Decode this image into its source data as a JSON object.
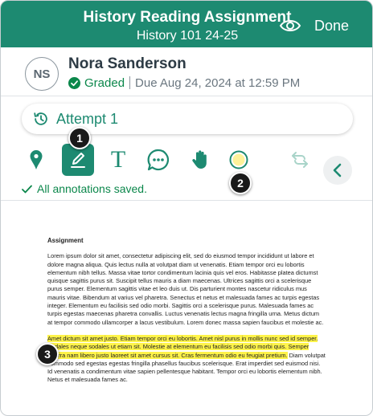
{
  "header": {
    "title": "History Reading Assignment",
    "subtitle": "History 101 24-25",
    "done_label": "Done"
  },
  "student": {
    "initials": "NS",
    "name": "Nora Sanderson",
    "status": "Graded",
    "due": "Due Aug 24, 2024 at 12:59 PM"
  },
  "attempt": {
    "label": "Attempt 1"
  },
  "toolbar": {
    "tools": [
      "pin-icon",
      "pen-icon",
      "text-icon",
      "comment-icon",
      "hand-icon",
      "color-picker"
    ],
    "active_tool": "pen-icon",
    "text_tool_glyph": "T",
    "saved_message": "All annotations saved."
  },
  "callouts": [
    "1",
    "2",
    "3"
  ],
  "colors": {
    "brand": "#1d8a71",
    "success": "#0b874b",
    "highlight": "#fff34a",
    "selected_color": "#fdf29a"
  },
  "document": {
    "title": "Assignment",
    "paragraph1": "Lorem ipsum dolor sit amet, consectetur adipiscing elit, sed do eiusmod tempor incididunt ut labore et dolore magna aliqua. Quis lectus nulla at volutpat diam ut venenatis. Etiam tempor orci eu lobortis elementum nibh tellus. Massa vitae tortor condimentum lacinia quis vel eros. Habitasse platea dictumst quisque sagittis purus sit. Suscipit tellus mauris a diam maecenas. Ultrices sagittis orci a scelerisque purus semper. Elementum sagittis vitae et leo duis ut. Dis parturient montes nascetur ridiculus mus mauris vitae. Bibendum at varius vel pharetra. Senectus et netus et malesuada fames ac turpis egestas integer. Elementum eu facilisis sed odio morbi. Sagittis orci a scelerisque purus. Malesuada fames ac turpis egestas maecenas pharetra convallis. Luctus venenatis lectus magna fringilla urna. Metus dictum at tempor commodo ullamcorper a lacus vestibulum. Lorem donec massa sapien faucibus et molestie ac.",
    "paragraph2_highlighted": "Amet dictum sit amet justo. Etiam tempor orci eu lobortis. Amet nisl purus in mollis nunc sed id semper. Sodales neque sodales ut etiam sit. Molestie at elementum eu facilisis sed odio morbi quis. Semper viverra nam libero justo laoreet sit amet cursus sit. Cras fermentum odio eu feugiat pretium.",
    "paragraph2_rest": " Diam volutpat commodo sed egestas egestas fringilla phasellus faucibus scelerisque. Erat imperdiet sed euismod nisi. Id venenatis a condimentum vitae sapien pellentesque habitant. Tempor orci eu lobortis elementum nibh. Netus et malesuada fames ac."
  }
}
